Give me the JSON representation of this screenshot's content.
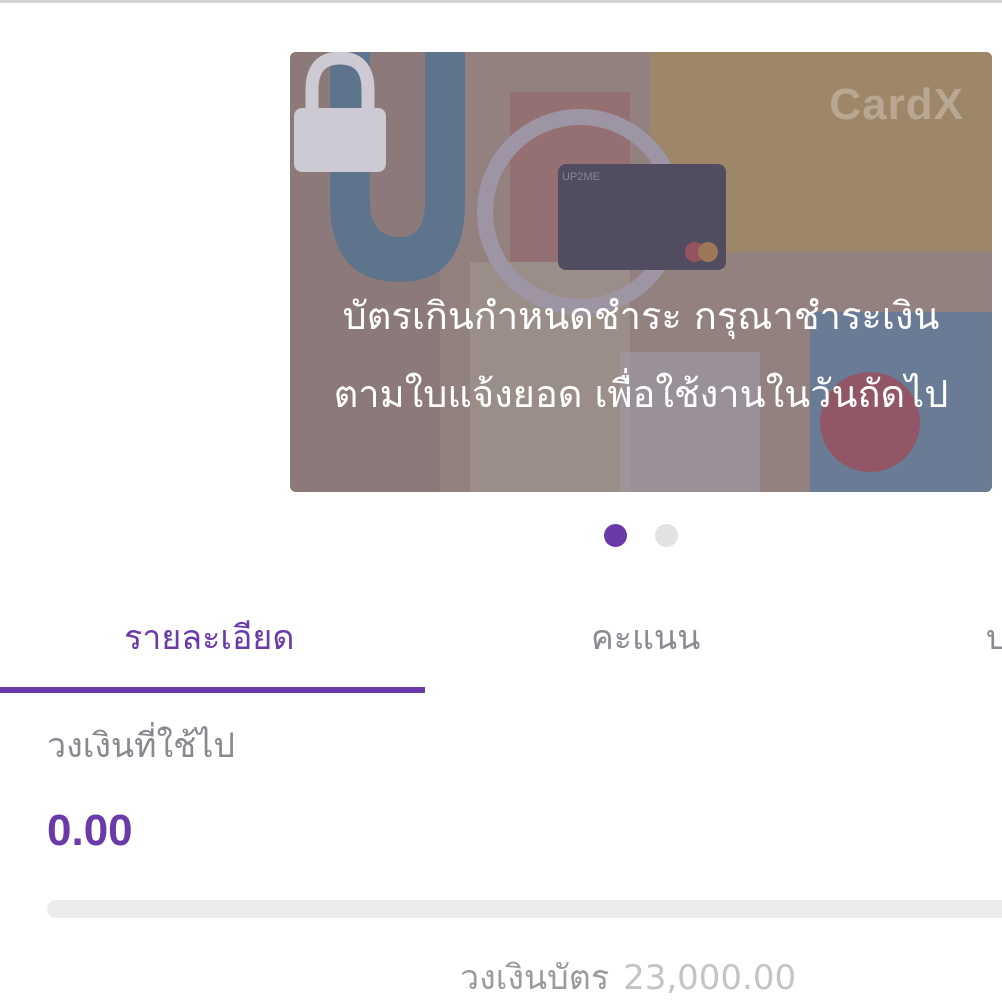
{
  "card": {
    "brand": "CardX",
    "locked_message_line1": "บัตรเกินกำหนดชำระ กรุณาชำระเงิน",
    "locked_message_line2": "ตามใบแจ้งยอด เพื่อใช้งานในวันถัดไป",
    "lock_icon": "lock-icon",
    "carousel_total": 2,
    "carousel_active_index": 0
  },
  "tabs": [
    {
      "label": "รายละเอียด",
      "active": true
    },
    {
      "label": "คะแนน",
      "active": false
    },
    {
      "label": "บ",
      "active": false
    }
  ],
  "usage": {
    "label": "วงเงินที่ใช้ไป",
    "value": "0.00",
    "progress_fraction": 0.0
  },
  "limit": {
    "label": "วงเงินบัตร",
    "value": "23,000.00"
  },
  "colors": {
    "accent": "#6a3aa8",
    "inactive_dot": "#e2e2e4",
    "inactive_tab": "#8a8a92"
  }
}
